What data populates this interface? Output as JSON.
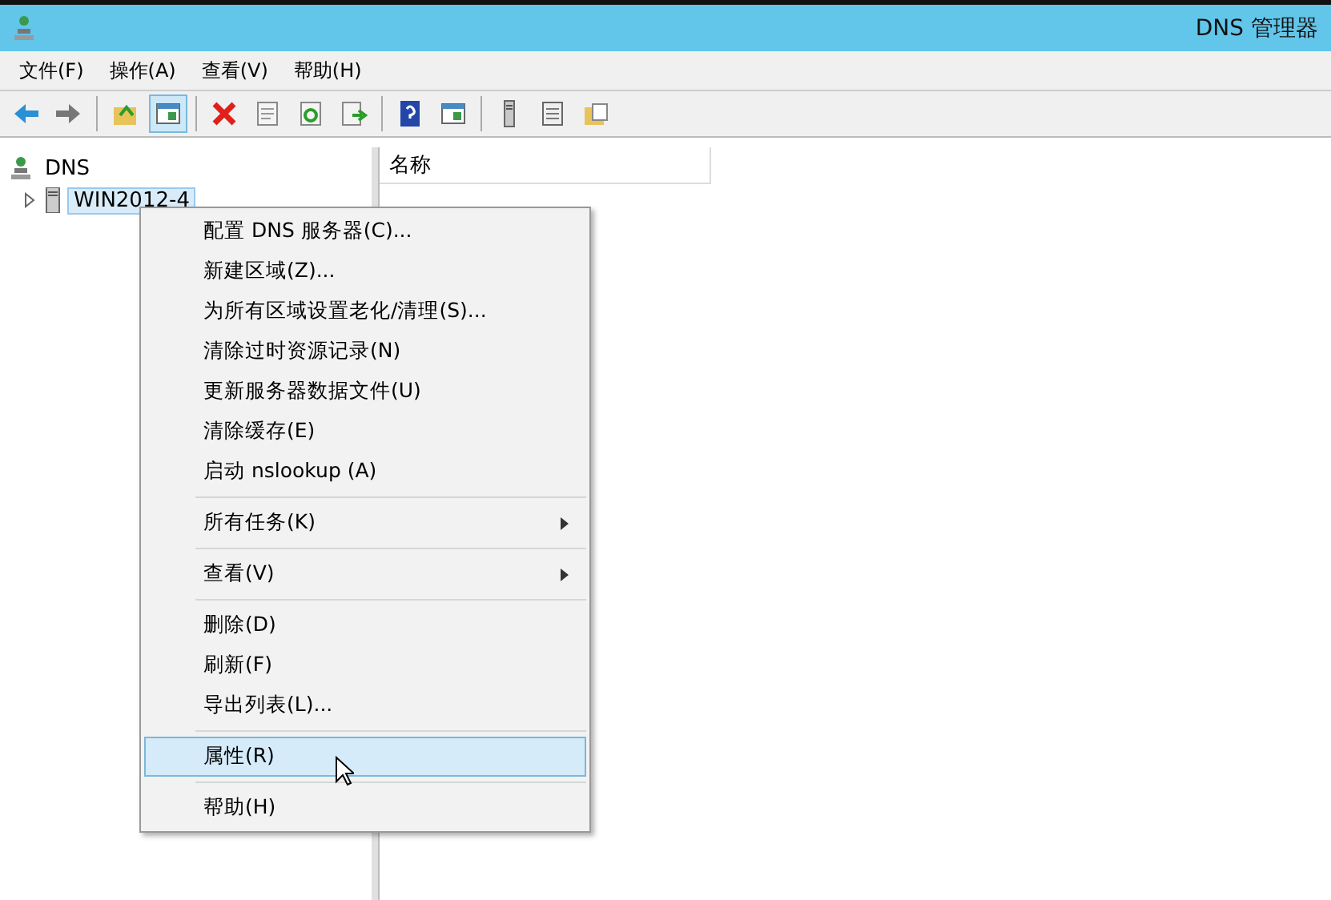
{
  "window": {
    "title": "DNS 管理器"
  },
  "menubar": [
    "文件(F)",
    "操作(A)",
    "查看(V)",
    "帮助(H)"
  ],
  "toolbar": [
    {
      "kind": "back"
    },
    {
      "kind": "forward"
    },
    {
      "kind": "sep"
    },
    {
      "kind": "up"
    },
    {
      "kind": "pane",
      "selected": true
    },
    {
      "kind": "sep"
    },
    {
      "kind": "delete"
    },
    {
      "kind": "props"
    },
    {
      "kind": "refresh"
    },
    {
      "kind": "export"
    },
    {
      "kind": "sep"
    },
    {
      "kind": "help"
    },
    {
      "kind": "pane",
      "selected": false
    },
    {
      "kind": "sep"
    },
    {
      "kind": "server"
    },
    {
      "kind": "list"
    },
    {
      "kind": "folder"
    }
  ],
  "tree": [
    {
      "label": "DNS",
      "kind": "root",
      "children": [
        {
          "label": "WIN2012-4",
          "kind": "server",
          "expanded": false,
          "selected": true
        }
      ]
    }
  ],
  "list": {
    "columns": [
      "名称"
    ]
  },
  "context_menu": [
    {
      "kind": "item",
      "label": "配置 DNS 服务器(C)...",
      "selected": false
    },
    {
      "kind": "item",
      "label": "新建区域(Z)...",
      "selected": false
    },
    {
      "kind": "item",
      "label": "为所有区域设置老化/清理(S)...",
      "selected": false
    },
    {
      "kind": "item",
      "label": "清除过时资源记录(N)",
      "selected": false
    },
    {
      "kind": "item",
      "label": "更新服务器数据文件(U)",
      "selected": false
    },
    {
      "kind": "item",
      "label": "清除缓存(E)",
      "selected": false
    },
    {
      "kind": "item",
      "label": "启动 nslookup (A)",
      "selected": false
    },
    {
      "kind": "separator"
    },
    {
      "kind": "submenu",
      "label": "所有任务(K)",
      "selected": false
    },
    {
      "kind": "separator"
    },
    {
      "kind": "submenu",
      "label": "查看(V)",
      "selected": false
    },
    {
      "kind": "separator"
    },
    {
      "kind": "item",
      "label": "删除(D)",
      "selected": false
    },
    {
      "kind": "item",
      "label": "刷新(F)",
      "selected": false
    },
    {
      "kind": "item",
      "label": "导出列表(L)...",
      "selected": false
    },
    {
      "kind": "separator"
    },
    {
      "kind": "item",
      "label": "属性(R)",
      "selected": true
    },
    {
      "kind": "separator"
    },
    {
      "kind": "item",
      "label": "帮助(H)",
      "selected": false
    }
  ]
}
